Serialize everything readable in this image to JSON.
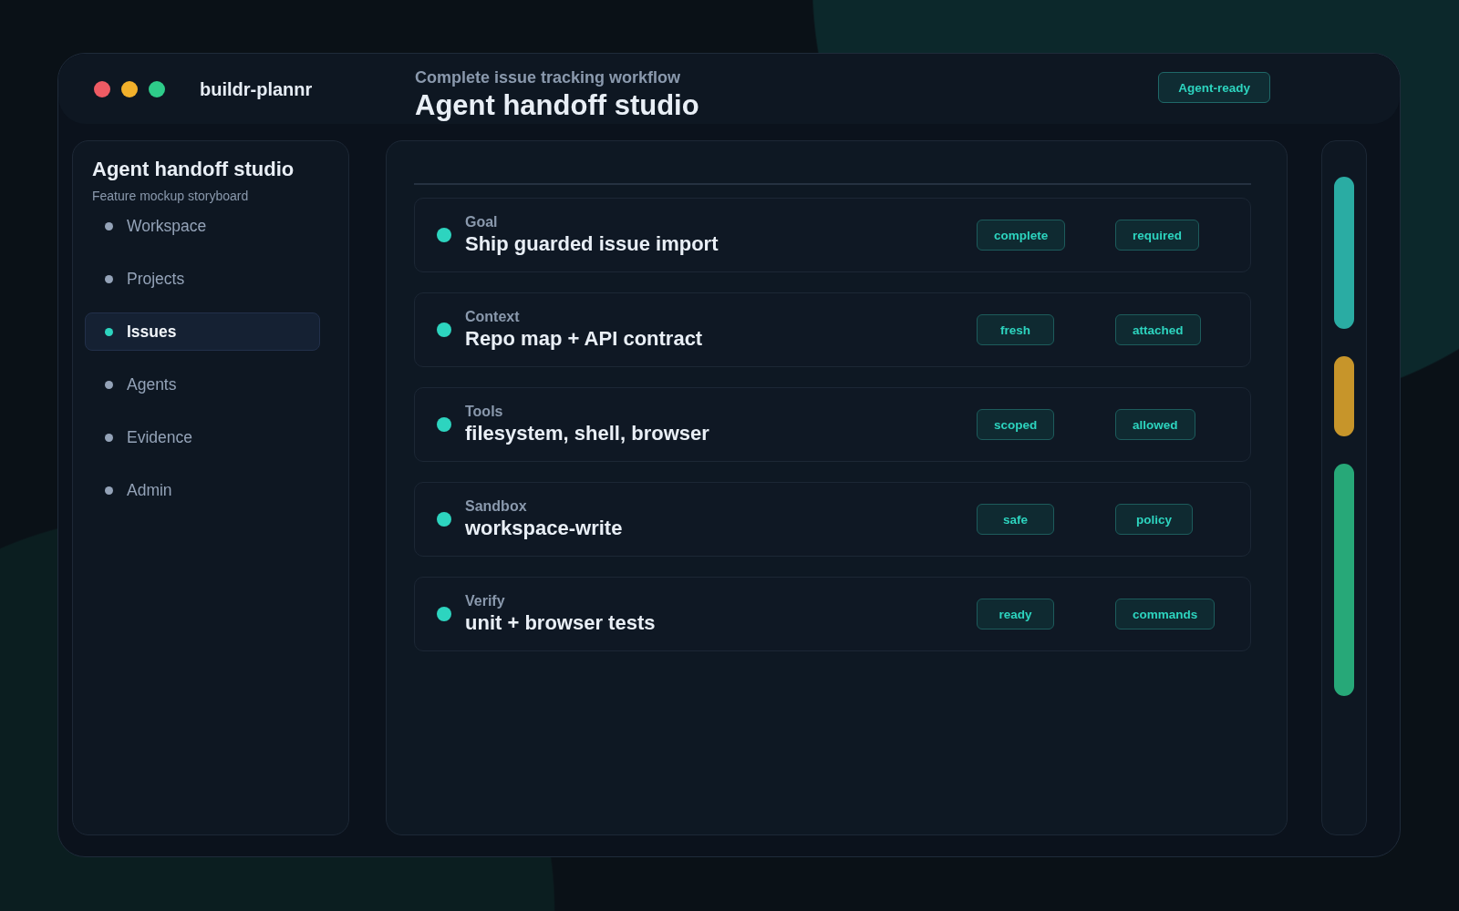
{
  "app": {
    "name": "buildr-plannr"
  },
  "header": {
    "eyebrow": "Complete issue tracking workflow",
    "title": "Agent handoff studio",
    "badge": "Agent-ready"
  },
  "sidebar": {
    "title": "Agent handoff studio",
    "subtitle": "Feature mockup storyboard",
    "items": [
      {
        "label": "Workspace",
        "selected": false
      },
      {
        "label": "Projects",
        "selected": false
      },
      {
        "label": "Issues",
        "selected": true
      },
      {
        "label": "Agents",
        "selected": false
      },
      {
        "label": "Evidence",
        "selected": false
      },
      {
        "label": "Admin",
        "selected": false
      }
    ]
  },
  "checklist": {
    "rows": [
      {
        "label": "Goal",
        "value": "Ship guarded issue import",
        "tags": [
          "complete",
          "required"
        ]
      },
      {
        "label": "Context",
        "value": "Repo map + API contract",
        "tags": [
          "fresh",
          "attached"
        ]
      },
      {
        "label": "Tools",
        "value": "filesystem, shell, browser",
        "tags": [
          "scoped",
          "allowed"
        ]
      },
      {
        "label": "Sandbox",
        "value": "workspace-write",
        "tags": [
          "safe",
          "policy"
        ]
      },
      {
        "label": "Verify",
        "value": "unit + browser tests",
        "tags": [
          "ready",
          "commands"
        ]
      }
    ]
  }
}
